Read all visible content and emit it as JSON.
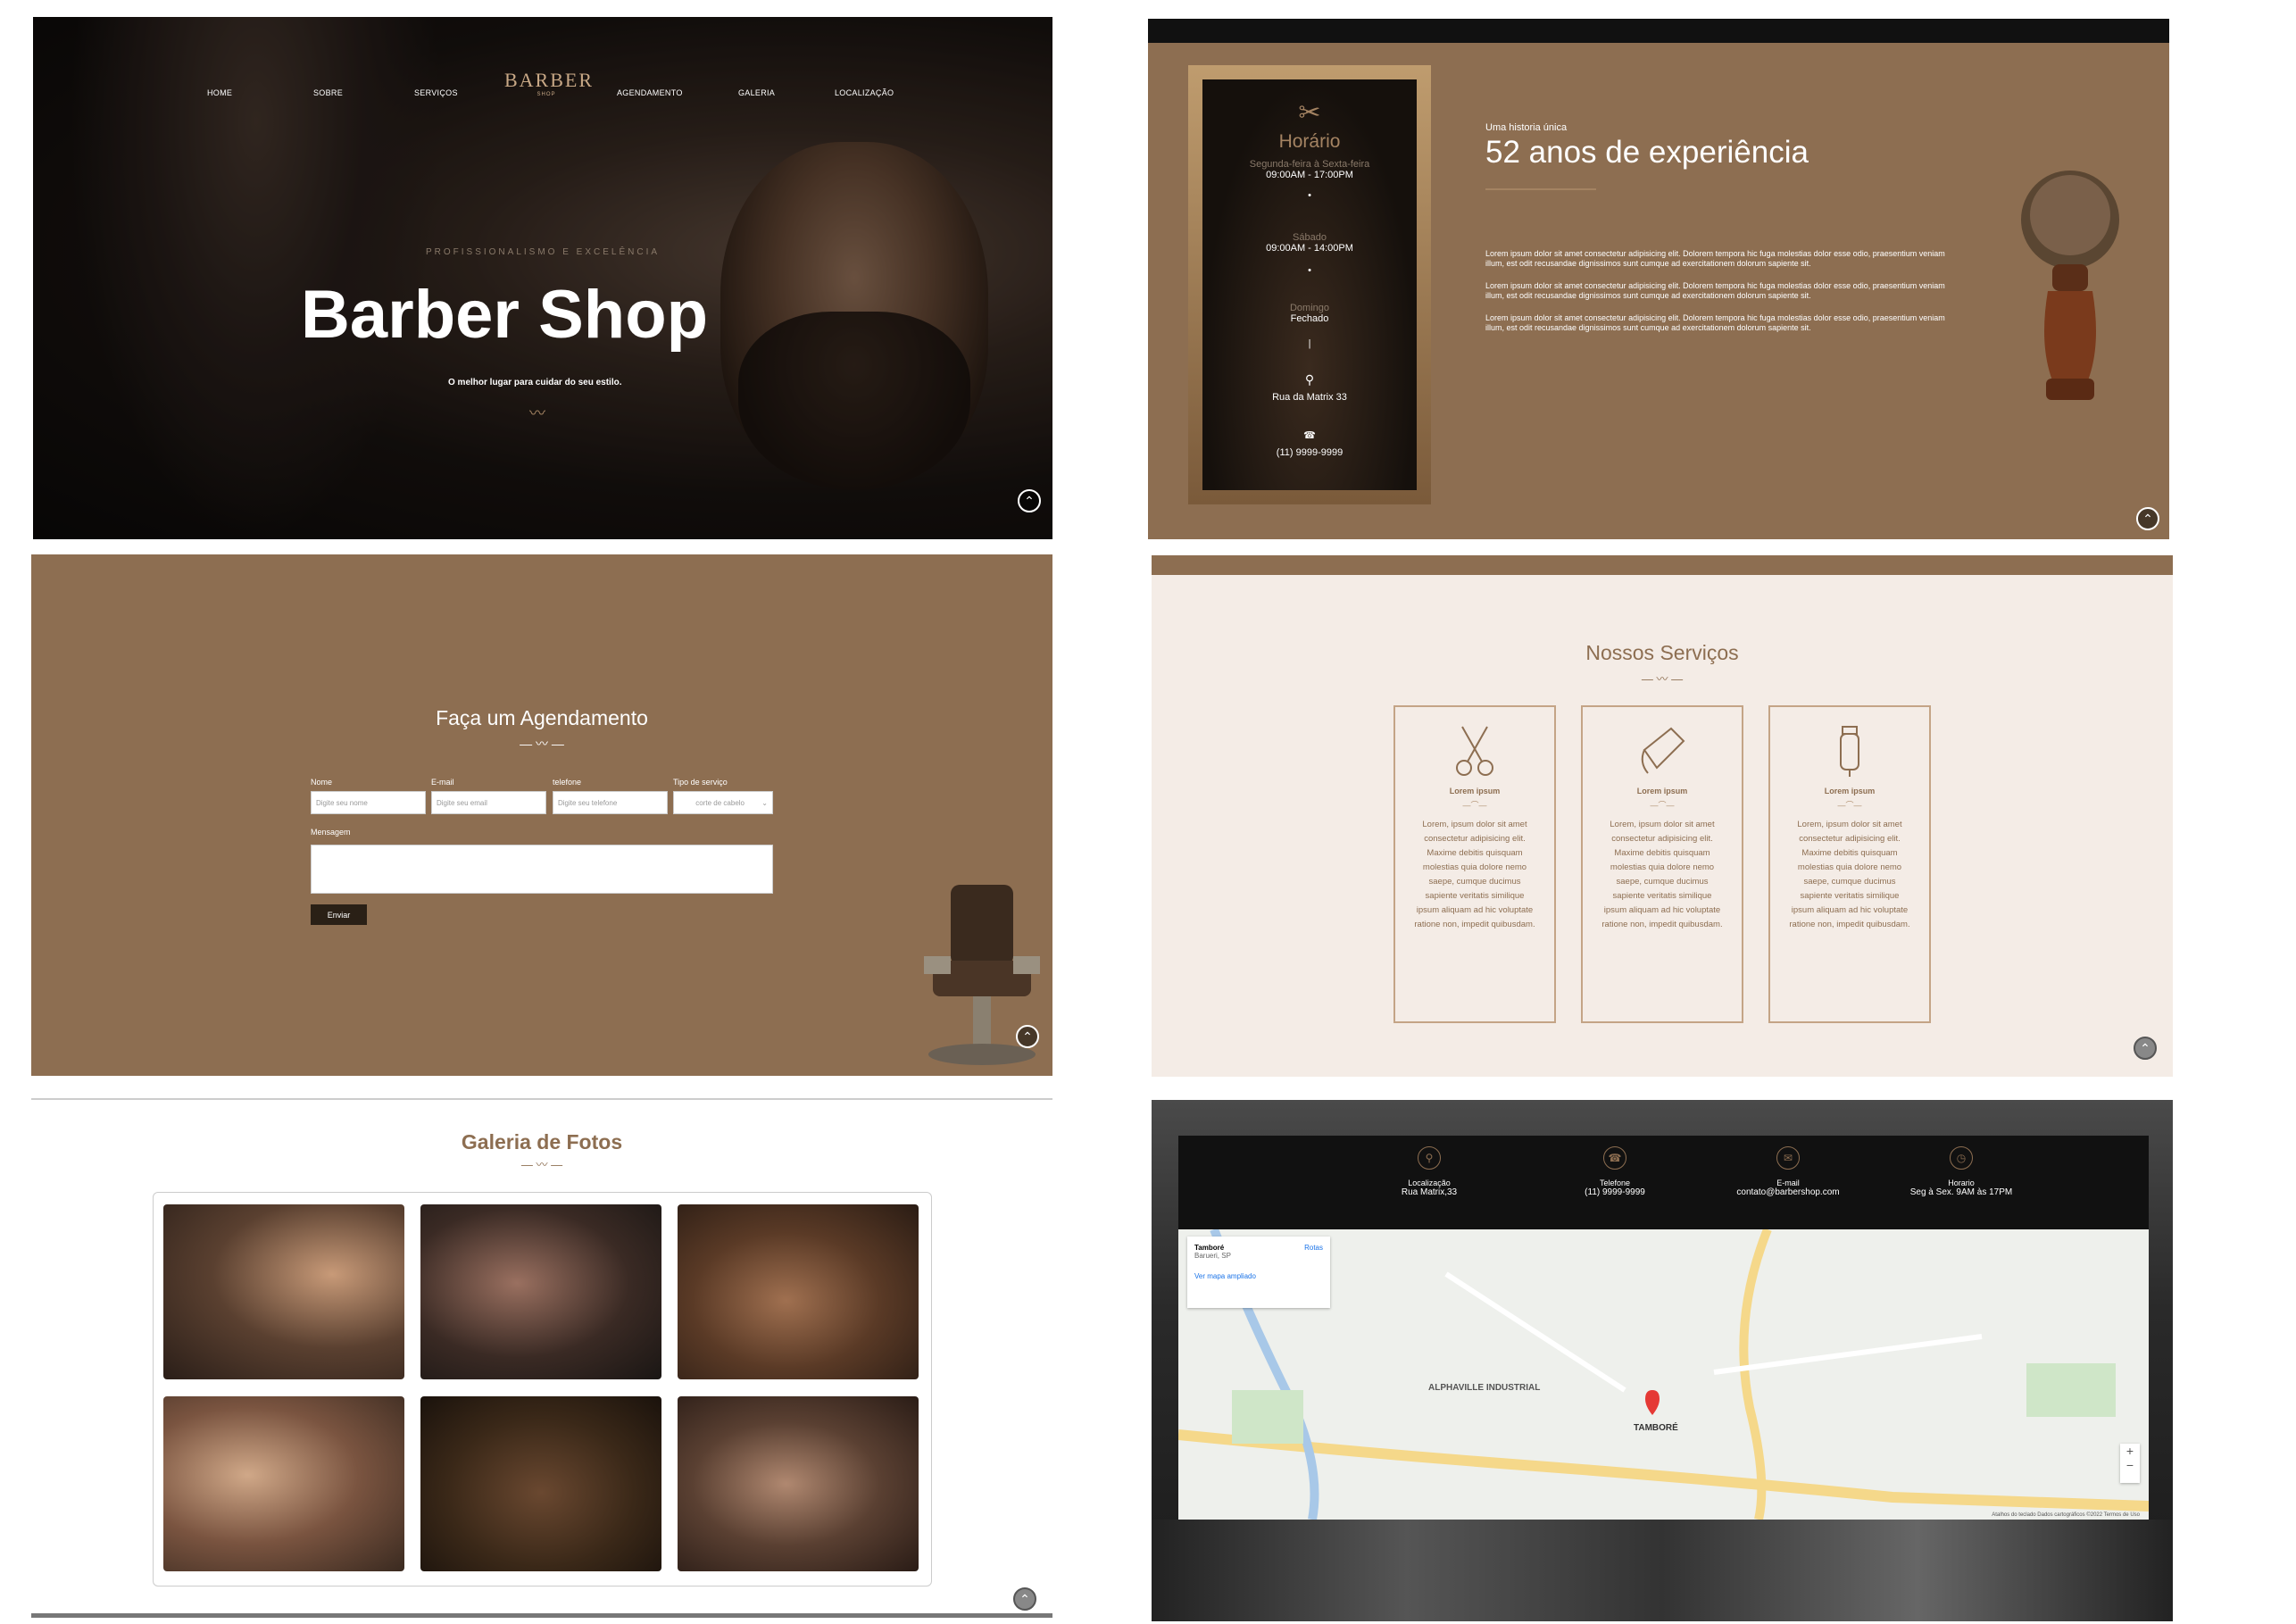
{
  "hero": {
    "nav": [
      "HOME",
      "SOBRE",
      "SERVIÇOS",
      "AGENDAMENTO",
      "GALERIA",
      "LOCALIZAÇÃO"
    ],
    "logo_main": "BARBER",
    "logo_sub": "SHOP",
    "tagline": "PROFISSIONALISMO E EXCELÊNCIA",
    "title": "Barber Shop",
    "subtitle": "O melhor lugar para cuidar do seu estilo."
  },
  "about": {
    "card": {
      "title": "Horário",
      "weekdays_label": "Segunda-feira à Sexta-feira",
      "weekdays_hours": "09:00AM - 17:00PM",
      "saturday_label": "Sábado",
      "saturday_hours": "09:00AM - 14:00PM",
      "sunday_label": "Domingo",
      "sunday_hours": "Fechado",
      "address": "Rua da Matrix 33",
      "phone": "(11) 9999-9999"
    },
    "eyebrow": "Uma historia única",
    "title": "52 anos de experiência",
    "paragraphs": [
      "Lorem ipsum dolor sit amet consectetur adipisicing elit. Dolorem tempora hic fuga molestias dolor esse odio, praesentium veniam illum, est odit recusandae dignissimos sunt cumque ad exercitationem dolorum sapiente sit.",
      "Lorem ipsum dolor sit amet consectetur adipisicing elit. Dolorem tempora hic fuga molestias dolor esse odio, praesentium veniam illum, est odit recusandae dignissimos sunt cumque ad exercitationem dolorum sapiente sit.",
      "Lorem ipsum dolor sit amet consectetur adipisicing elit. Dolorem tempora hic fuga molestias dolor esse odio, praesentium veniam illum, est odit recusandae dignissimos sunt cumque ad exercitationem dolorum sapiente sit."
    ]
  },
  "agenda": {
    "title": "Faça um Agendamento",
    "fields": {
      "name_label": "Nome",
      "name_placeholder": "Digite seu nome",
      "email_label": "E-mail",
      "email_placeholder": "Digite seu email",
      "phone_label": "telefone",
      "phone_placeholder": "Digite seu telefone",
      "service_label": "Tipo de serviço",
      "service_value": "corte de cabelo",
      "message_label": "Mensagem"
    },
    "submit": "Enviar"
  },
  "services": {
    "title": "Nossos Serviços",
    "items": [
      {
        "icon": "scissors-icon",
        "title": "Lorem ipsum",
        "text": "Lorem, ipsum dolor sit amet consectetur adipisicing elit. Maxime debitis quisquam molestias quia dolore nemo saepe, cumque ducimus sapiente veritatis similique ipsum aliquam ad hic voluptate ratione non, impedit quibusdam."
      },
      {
        "icon": "razor-icon",
        "title": "Lorem ipsum",
        "text": "Lorem, ipsum dolor sit amet consectetur adipisicing elit. Maxime debitis quisquam molestias quia dolore nemo saepe, cumque ducimus sapiente veritatis similique ipsum aliquam ad hic voluptate ratione non, impedit quibusdam."
      },
      {
        "icon": "clipper-icon",
        "title": "Lorem ipsum",
        "text": "Lorem, ipsum dolor sit amet consectetur adipisicing elit. Maxime debitis quisquam molestias quia dolore nemo saepe, cumque ducimus sapiente veritatis similique ipsum aliquam ad hic voluptate ratione non, impedit quibusdam."
      }
    ]
  },
  "gallery": {
    "title": "Galeria de Fotos",
    "photos": [
      "photo-1",
      "photo-2",
      "photo-3",
      "photo-4",
      "photo-5",
      "photo-6"
    ]
  },
  "contact": {
    "items": [
      {
        "icon": "location-icon",
        "label": "Localização",
        "value": "Rua Matrix,33"
      },
      {
        "icon": "phone-icon",
        "label": "Telefone",
        "value": "(11) 9999-9999"
      },
      {
        "icon": "email-icon",
        "label": "E-mail",
        "value": "contato@barbershop.com"
      },
      {
        "icon": "clock-icon",
        "label": "Horario",
        "value": "Seg à Sex. 9AM às 17PM"
      }
    ],
    "map": {
      "place": "Tamboré",
      "region": "Barueri, SP",
      "route": "Rotas",
      "larger_map": "Ver mapa ampliado",
      "area_label": "ALPHAVILLE INDUSTRIAL",
      "pin_label": "TAMBORÉ",
      "footer": "Atalhos do teclado   Dados cartográficos ©2022   Termos de Uso"
    }
  },
  "colors": {
    "brand": "#8d6e51",
    "light": "#f4ece6",
    "dark": "#111111"
  }
}
